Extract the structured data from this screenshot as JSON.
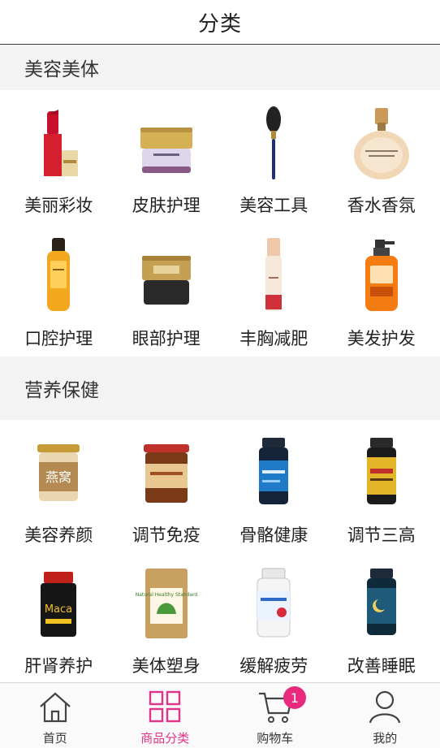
{
  "header": {
    "title": "分类"
  },
  "sections": [
    {
      "title": "美容美体",
      "items": [
        {
          "label": "美丽彩妆",
          "icon": "lipstick-icon"
        },
        {
          "label": "皮肤护理",
          "icon": "cream-jar-icon"
        },
        {
          "label": "美容工具",
          "icon": "makeup-brush-icon"
        },
        {
          "label": "香水香氛",
          "icon": "perfume-bottle-icon"
        },
        {
          "label": "口腔护理",
          "icon": "yellow-bottle-icon"
        },
        {
          "label": "眼部护理",
          "icon": "eye-cream-jar-icon"
        },
        {
          "label": "丰胸减肥",
          "icon": "pump-bottle-icon"
        },
        {
          "label": "美发护发",
          "icon": "shampoo-bottle-icon"
        }
      ]
    },
    {
      "title": "营养保健",
      "items": [
        {
          "label": "美容养颜",
          "icon": "birdnest-jar-icon"
        },
        {
          "label": "调节免疫",
          "icon": "honey-jar-icon"
        },
        {
          "label": "骨骼健康",
          "icon": "supplement-bottle-blue-icon"
        },
        {
          "label": "调节三高",
          "icon": "supplement-bottle-gold-icon"
        },
        {
          "label": "肝肾养护",
          "icon": "maca-bottle-icon"
        },
        {
          "label": "美体塑身",
          "icon": "healthy-pouch-icon"
        },
        {
          "label": "缓解疲劳",
          "icon": "supplement-bottle-white-icon"
        },
        {
          "label": "改善睡眠",
          "icon": "sleep-bottle-icon"
        }
      ]
    }
  ],
  "product_texts": {
    "birdnest": "燕窝",
    "maca": "Maca",
    "pouch": "Natural Healthy Standard"
  },
  "tabbar": {
    "tabs": [
      {
        "label": "首页",
        "icon": "home-icon"
      },
      {
        "label": "商品分类",
        "icon": "category-grid-icon"
      },
      {
        "label": "购物车",
        "icon": "cart-icon"
      },
      {
        "label": "我的",
        "icon": "user-icon"
      }
    ],
    "active_index": 1,
    "cart_badge": "1"
  },
  "colors": {
    "accent": "#e0338a",
    "badge": "#e8297d",
    "section_bg": "#f3f3f3"
  }
}
